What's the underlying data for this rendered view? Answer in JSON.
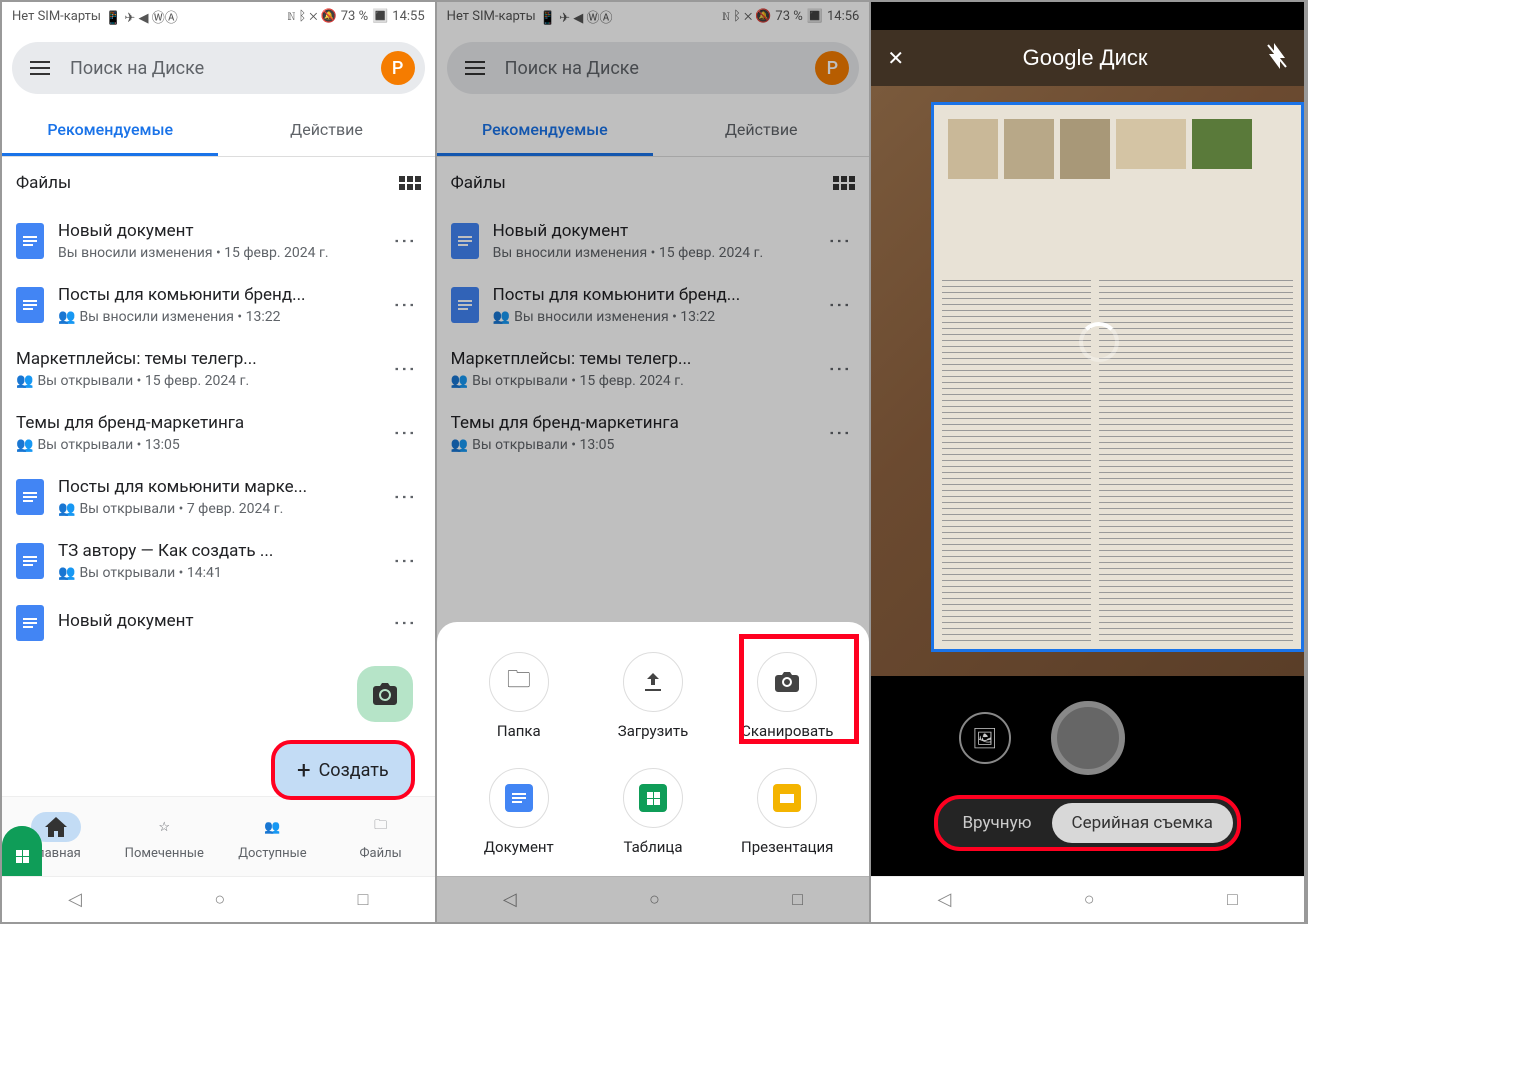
{
  "status": {
    "left": "Нет SIM-карты",
    "battery": "73 %",
    "time1": "14:55",
    "time2": "14:56"
  },
  "search": {
    "placeholder": "Поиск на Диске",
    "avatarLetter": "P"
  },
  "tabs": {
    "rec": "Рекомендуемые",
    "act": "Действие"
  },
  "sectionLabel": "Файлы",
  "files": [
    {
      "icon": "doc",
      "title": "Новый документ",
      "meta": "Вы вносили изменения • 15 февр. 2024 г.",
      "shared": false
    },
    {
      "icon": "doc",
      "title": "Посты для комьюнити бренд...",
      "meta": "Вы вносили изменения • 13:22",
      "shared": true
    },
    {
      "icon": "sheet",
      "title": "Маркетплейсы: темы телегр...",
      "meta": "Вы открывали • 15 февр. 2024 г.",
      "shared": true
    },
    {
      "icon": "sheet",
      "title": "Темы для бренд-маркетинга",
      "meta": "Вы открывали • 13:05",
      "shared": true
    },
    {
      "icon": "doc",
      "title": "Посты для комьюнити марке...",
      "meta": "Вы открывали • 7 февр. 2024 г.",
      "shared": true
    },
    {
      "icon": "doc",
      "title": "ТЗ автору — Как создать ...",
      "meta": "Вы открывали • 14:41",
      "shared": true
    },
    {
      "icon": "doc",
      "title": "Новый документ",
      "meta": "",
      "shared": false
    }
  ],
  "fab": {
    "create": "Создать"
  },
  "nav": {
    "home": "Главная",
    "starred": "Помеченные",
    "shared": "Доступные",
    "files": "Файлы"
  },
  "sheet": {
    "folder": "Папка",
    "upload": "Загрузить",
    "scan": "Сканировать",
    "doc": "Документ",
    "table": "Таблица",
    "pres": "Презентация"
  },
  "scanner": {
    "title": "Google Диск",
    "manual": "Вручную",
    "auto": "Серийная съемка"
  }
}
